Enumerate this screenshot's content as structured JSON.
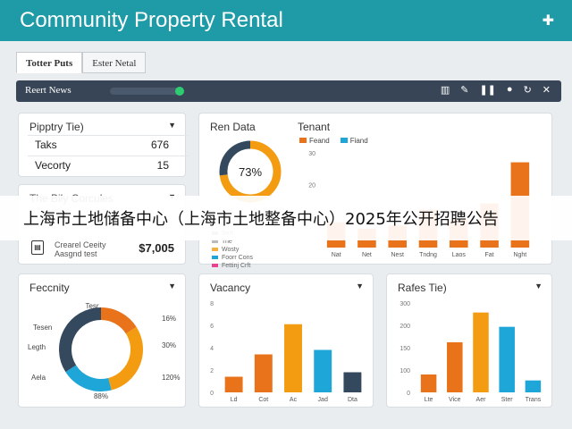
{
  "app": {
    "title": "Community Property Rental",
    "menu_icon": "plus-icon"
  },
  "tabs": [
    {
      "label": "Totter Puts",
      "active": true
    },
    {
      "label": "Ester Netal",
      "active": false
    }
  ],
  "toolbar": {
    "label": "Reert News",
    "icons": [
      "chart-icon",
      "pen-icon",
      "pause-icon",
      "record-icon",
      "refresh-icon",
      "close-icon"
    ],
    "status_color": "#2ecc71"
  },
  "property_file": {
    "title": "Pipptry Tie)",
    "rows": [
      {
        "label": "Taks",
        "value": "676"
      },
      {
        "label": "Vecorty",
        "value": "15"
      }
    ]
  },
  "bily_card": {
    "title": "The Bily Corcules",
    "line1": "Crearel Ceeity",
    "line2": "Aasgnd test",
    "amount": "$7,005"
  },
  "rent_data": {
    "title": "Ren Data",
    "donut_value": "73%",
    "legend": [
      "Sert",
      "Trie",
      "Wosty",
      "Foorr Cons",
      "Fettinj Crft"
    ]
  },
  "tenant": {
    "title": "Tenant",
    "legend": [
      "Feand",
      "Fiand"
    ]
  },
  "notice": {
    "text": "上海市土地储备中心（上海市土地整备中心）2025年公开招聘公告"
  },
  "feccnity": {
    "title": "Feccnity",
    "labels_left": [
      "Tesen",
      "Legth",
      "Aela"
    ],
    "labels_top": "Tesr",
    "labels_right": [
      "16%",
      "30%",
      "120%"
    ],
    "label_bottom": "88%"
  },
  "vacancy": {
    "title": "Vacancy"
  },
  "rates": {
    "title": "Rafes Tie)"
  },
  "colors": {
    "orange": "#f39c12",
    "orange_dark": "#e8731a",
    "blue": "#1fa6d9",
    "navy": "#34495e",
    "teal": "#1f9aa7"
  },
  "chart_data": [
    {
      "type": "pie",
      "title": "Ren Data",
      "values": [
        73,
        27
      ],
      "labels": [
        "73%",
        ""
      ]
    },
    {
      "type": "bar",
      "title": "Tenant",
      "categories": [
        "Nat",
        "Net",
        "Nest",
        "Tndng",
        "Laos",
        "Fat",
        "Nght"
      ],
      "series": [
        {
          "name": "Feand",
          "values": [
            8,
            6,
            7,
            12,
            9,
            14,
            27
          ]
        }
      ],
      "ylim": [
        0,
        30
      ],
      "yticks": [
        "30",
        "20",
        "10",
        ""
      ]
    },
    {
      "type": "pie",
      "title": "Feccnity",
      "values": [
        16,
        30,
        20,
        34
      ],
      "labels": [
        "16%",
        "30%",
        "120%",
        "88%"
      ]
    },
    {
      "type": "bar",
      "title": "Vacancy",
      "categories": [
        "Ld",
        "Cot",
        "Ac",
        "Jad",
        "Dta"
      ],
      "series": [
        {
          "values": [
            1.4,
            3.4,
            6.1,
            3.8,
            1.8
          ]
        }
      ],
      "ylim": [
        0,
        8
      ],
      "yticks": [
        "8",
        "6",
        "4",
        "2",
        "0"
      ]
    },
    {
      "type": "bar",
      "title": "Rafes Tie)",
      "categories": [
        "Lte",
        "Vice",
        "Aer",
        "Ster",
        "Trans"
      ],
      "series": [
        {
          "values": [
            60,
            168,
            268,
            220,
            40
          ]
        }
      ],
      "ylim": [
        0,
        300
      ],
      "yticks": [
        "300",
        "200",
        "150",
        "100",
        "0"
      ]
    }
  ]
}
